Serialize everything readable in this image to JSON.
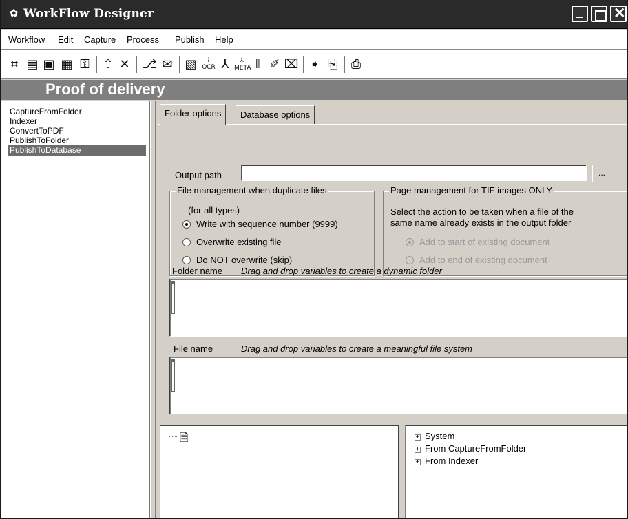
{
  "window": {
    "title": "WorkFlow Designer",
    "icon": "workflow-gear-icon"
  },
  "menu": [
    "Workflow",
    "Edit",
    "Capture",
    "Process",
    "Publish",
    "Help"
  ],
  "toolbar": {
    "icons": [
      "new-workflow-icon",
      "open-icon",
      "save-icon",
      "save-as-icon",
      "lock-icon",
      "move-up-icon",
      "delete-icon",
      "capture-folder-icon",
      "capture-email-icon",
      "indexer-icon",
      "ocr-icon",
      "convert-pdf-icon",
      "pdf-meta-icon",
      "barcode-icon",
      "signature-icon",
      "scan-icon",
      "publish-folder-icon",
      "publish-database-icon",
      "preview-icon"
    ]
  },
  "banner": {
    "title": "Proof of delivery"
  },
  "steps": [
    {
      "label": "CaptureFromFolder",
      "selected": false
    },
    {
      "label": "Indexer",
      "selected": false
    },
    {
      "label": "ConvertToPDF",
      "selected": false
    },
    {
      "label": "PublishToFolder",
      "selected": false
    },
    {
      "label": "PublishToDatabase",
      "selected": true
    }
  ],
  "tabs": {
    "folder": "Folder options",
    "database": "Database options",
    "active": "Folder options"
  },
  "output": {
    "label": "Output path",
    "value": "",
    "browse_label": "..."
  },
  "file_management": {
    "title": "File management when duplicate files",
    "note": "(for all types)",
    "options": [
      {
        "label": "Write with sequence number (9999)",
        "checked": true
      },
      {
        "label": "Overwrite existing file",
        "checked": false
      },
      {
        "label": "Do NOT overwrite (skip)",
        "checked": false
      }
    ]
  },
  "page_management": {
    "title": "Page management for TIF images ONLY",
    "description_line1": "Select the action to be taken when a file of the",
    "description_line2": "same name already exists in the output folder",
    "options": [
      {
        "label": "Add to start of existing document",
        "checked": true,
        "enabled": false
      },
      {
        "label": "Add to end of existing document",
        "checked": false,
        "enabled": false
      }
    ]
  },
  "folder_name": {
    "label": "Folder name",
    "hint": "Drag and drop variables to create a dynamic folder"
  },
  "file_name": {
    "label": "File name",
    "hint": "Drag and drop variables to create a meaningful file system"
  },
  "variables_tree": [
    "System",
    "From CaptureFromFolder",
    "From Indexer"
  ]
}
